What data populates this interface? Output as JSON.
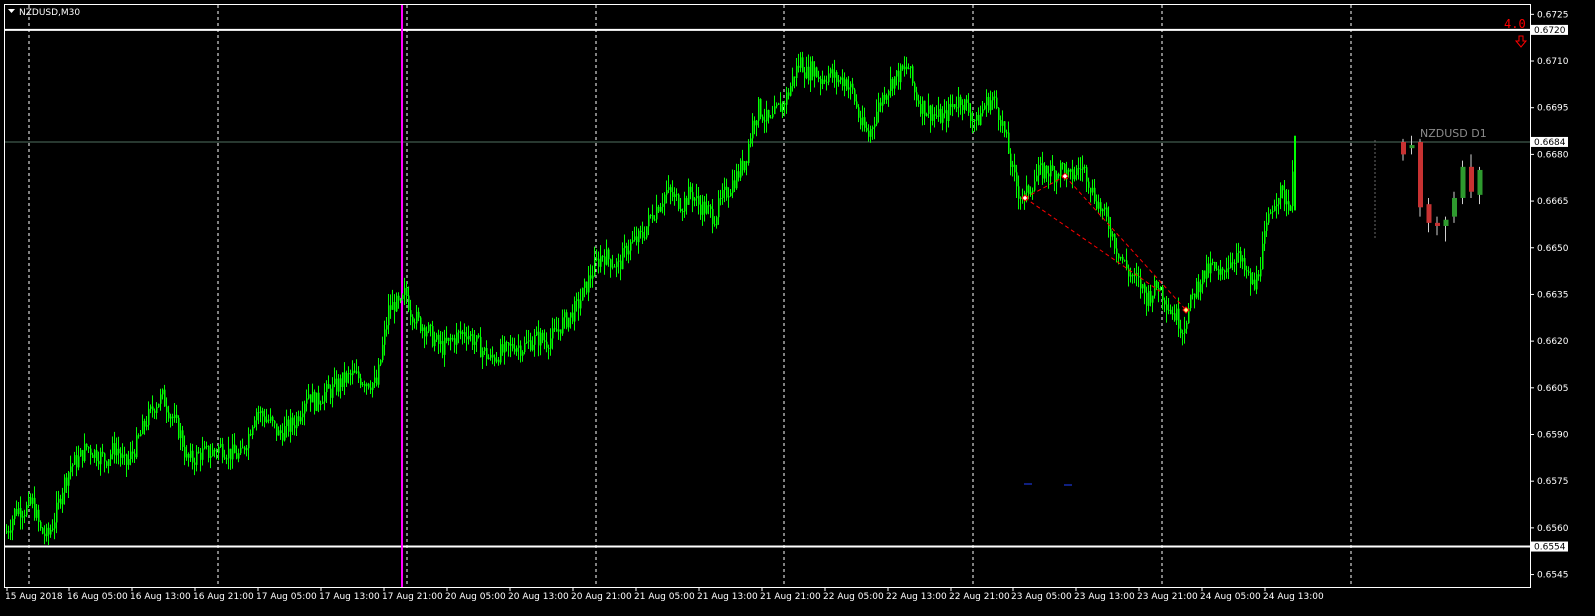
{
  "window": {
    "symbol_label": "NZDUSD,M30",
    "dropdown_icon": "triangle-down-icon"
  },
  "colors": {
    "background": "#000000",
    "bull_candle": "#00ff00",
    "bear_candle": "#00ff00",
    "grid": "#ffffff",
    "axis_text": "#ffffff",
    "bid_line": "#4f6f5f",
    "vertical_marker": "#ff00ff",
    "zigzag": "#ff0000",
    "level_line": "#ffffff",
    "alert_text": "#ff0000",
    "d1_label": "#8c8c8c",
    "d1_bull": "#2e9a2e",
    "d1_bear": "#c83232"
  },
  "chart_data": {
    "type": "candlestick",
    "title": "NZDUSD,M30",
    "y_ticks": [
      "0.6725",
      "0.6710",
      "0.6695",
      "0.6680",
      "0.6665",
      "0.6650",
      "0.6635",
      "0.6620",
      "0.6605",
      "0.6590",
      "0.6575",
      "0.6560",
      "0.6545"
    ],
    "ylim": [
      0.6541,
      0.6728
    ],
    "x_ticks": [
      "15 Aug 2018",
      "16 Aug 05:00",
      "16 Aug 13:00",
      "16 Aug 21:00",
      "17 Aug 05:00",
      "17 Aug 13:00",
      "17 Aug 21:00",
      "20 Aug 05:00",
      "20 Aug 13:00",
      "20 Aug 21:00",
      "21 Aug 05:00",
      "21 Aug 13:00",
      "21 Aug 21:00",
      "22 Aug 05:00",
      "22 Aug 13:00",
      "22 Aug 21:00",
      "23 Aug 05:00",
      "23 Aug 13:00",
      "23 Aug 21:00",
      "24 Aug 05:00",
      "24 Aug 13:00"
    ],
    "price_labels": {
      "upper_level": "0.6720",
      "bid": "0.6684",
      "lower_level": "0.6554"
    },
    "upper_level": 0.672,
    "bid": 0.6684,
    "lower_level": 0.6554,
    "close_path": [
      [
        0,
        0.6556
      ],
      [
        8,
        0.656
      ],
      [
        15,
        0.6566
      ],
      [
        25,
        0.6566
      ],
      [
        32,
        0.6568
      ],
      [
        40,
        0.6559
      ],
      [
        47,
        0.6557
      ],
      [
        55,
        0.6564
      ],
      [
        62,
        0.6573
      ],
      [
        70,
        0.658
      ],
      [
        78,
        0.6582
      ],
      [
        86,
        0.6586
      ],
      [
        95,
        0.6584
      ],
      [
        105,
        0.6582
      ],
      [
        115,
        0.6586
      ],
      [
        125,
        0.658
      ],
      [
        135,
        0.6586
      ],
      [
        145,
        0.6594
      ],
      [
        155,
        0.66
      ],
      [
        162,
        0.6602
      ],
      [
        168,
        0.6598
      ],
      [
        174,
        0.6594
      ],
      [
        180,
        0.659
      ],
      [
        186,
        0.6582
      ],
      [
        192,
        0.6582
      ],
      [
        200,
        0.6584
      ],
      [
        210,
        0.6584
      ],
      [
        220,
        0.6586
      ],
      [
        230,
        0.6584
      ],
      [
        240,
        0.6583
      ],
      [
        248,
        0.659
      ],
      [
        255,
        0.6598
      ],
      [
        262,
        0.6596
      ],
      [
        270,
        0.6594
      ],
      [
        278,
        0.659
      ],
      [
        286,
        0.6592
      ],
      [
        294,
        0.6594
      ],
      [
        300,
        0.6598
      ],
      [
        307,
        0.6604
      ],
      [
        315,
        0.66
      ],
      [
        322,
        0.6603
      ],
      [
        330,
        0.6604
      ],
      [
        337,
        0.6606
      ],
      [
        345,
        0.6608
      ],
      [
        352,
        0.6609
      ],
      [
        360,
        0.6608
      ],
      [
        368,
        0.6607
      ],
      [
        376,
        0.6606
      ],
      [
        382,
        0.6618
      ],
      [
        388,
        0.663
      ],
      [
        394,
        0.6632
      ],
      [
        400,
        0.6631
      ],
      [
        405,
        0.6636
      ],
      [
        410,
        0.663
      ],
      [
        418,
        0.6626
      ],
      [
        426,
        0.6624
      ],
      [
        434,
        0.662
      ],
      [
        442,
        0.6618
      ],
      [
        450,
        0.662
      ],
      [
        458,
        0.6622
      ],
      [
        466,
        0.6623
      ],
      [
        474,
        0.662
      ],
      [
        482,
        0.6617
      ],
      [
        490,
        0.6614
      ],
      [
        498,
        0.6616
      ],
      [
        506,
        0.6617
      ],
      [
        514,
        0.6619
      ],
      [
        522,
        0.6618
      ],
      [
        530,
        0.662
      ],
      [
        538,
        0.6621
      ],
      [
        546,
        0.662
      ],
      [
        554,
        0.6622
      ],
      [
        562,
        0.6626
      ],
      [
        570,
        0.6628
      ],
      [
        578,
        0.6632
      ],
      [
        586,
        0.6638
      ],
      [
        594,
        0.6644
      ],
      [
        602,
        0.6648
      ],
      [
        610,
        0.6646
      ],
      [
        618,
        0.6644
      ],
      [
        626,
        0.665
      ],
      [
        634,
        0.6652
      ],
      [
        642,
        0.6654
      ],
      [
        650,
        0.666
      ],
      [
        658,
        0.6664
      ],
      [
        666,
        0.6668
      ],
      [
        674,
        0.6666
      ],
      [
        682,
        0.6664
      ],
      [
        690,
        0.6668
      ],
      [
        698,
        0.6664
      ],
      [
        706,
        0.6662
      ],
      [
        714,
        0.666
      ],
      [
        722,
        0.6666
      ],
      [
        730,
        0.667
      ],
      [
        738,
        0.6674
      ],
      [
        746,
        0.668
      ],
      [
        752,
        0.669
      ],
      [
        758,
        0.6695
      ],
      [
        764,
        0.6692
      ],
      [
        770,
        0.669
      ],
      [
        776,
        0.6694
      ],
      [
        782,
        0.6696
      ],
      [
        788,
        0.67
      ],
      [
        794,
        0.6706
      ],
      [
        800,
        0.671
      ],
      [
        806,
        0.6706
      ],
      [
        812,
        0.6708
      ],
      [
        820,
        0.6704
      ],
      [
        828,
        0.6706
      ],
      [
        836,
        0.6704
      ],
      [
        844,
        0.6704
      ],
      [
        852,
        0.67
      ],
      [
        860,
        0.669
      ],
      [
        868,
        0.6686
      ],
      [
        876,
        0.6694
      ],
      [
        884,
        0.67
      ],
      [
        892,
        0.6704
      ],
      [
        900,
        0.6706
      ],
      [
        908,
        0.6708
      ],
      [
        914,
        0.67
      ],
      [
        920,
        0.6696
      ],
      [
        928,
        0.6694
      ],
      [
        936,
        0.6692
      ],
      [
        944,
        0.6692
      ],
      [
        952,
        0.6696
      ],
      [
        960,
        0.6698
      ],
      [
        968,
        0.6694
      ],
      [
        976,
        0.669
      ],
      [
        984,
        0.6696
      ],
      [
        992,
        0.6698
      ],
      [
        1000,
        0.6692
      ],
      [
        1006,
        0.6684
      ],
      [
        1012,
        0.6674
      ],
      [
        1018,
        0.6668
      ],
      [
        1024,
        0.6666
      ],
      [
        1030,
        0.667
      ],
      [
        1038,
        0.6674
      ],
      [
        1046,
        0.6675
      ],
      [
        1054,
        0.6674
      ],
      [
        1062,
        0.6676
      ],
      [
        1068,
        0.6672
      ],
      [
        1074,
        0.6674
      ],
      [
        1080,
        0.6676
      ],
      [
        1086,
        0.6674
      ],
      [
        1092,
        0.6668
      ],
      [
        1098,
        0.6664
      ],
      [
        1104,
        0.666
      ],
      [
        1110,
        0.6656
      ],
      [
        1116,
        0.665
      ],
      [
        1122,
        0.6646
      ],
      [
        1128,
        0.6642
      ],
      [
        1134,
        0.664
      ],
      [
        1140,
        0.6638
      ],
      [
        1146,
        0.6634
      ],
      [
        1152,
        0.6636
      ],
      [
        1158,
        0.6638
      ],
      [
        1164,
        0.6634
      ],
      [
        1170,
        0.663
      ],
      [
        1176,
        0.6628
      ],
      [
        1182,
        0.6624
      ],
      [
        1188,
        0.663
      ],
      [
        1194,
        0.6636
      ],
      [
        1200,
        0.664
      ],
      [
        1206,
        0.6642
      ],
      [
        1212,
        0.6644
      ],
      [
        1218,
        0.664
      ],
      [
        1224,
        0.6644
      ],
      [
        1230,
        0.6646
      ],
      [
        1236,
        0.6648
      ],
      [
        1242,
        0.6644
      ],
      [
        1248,
        0.664
      ],
      [
        1254,
        0.6637
      ],
      [
        1260,
        0.6646
      ],
      [
        1266,
        0.6656
      ],
      [
        1272,
        0.6664
      ],
      [
        1278,
        0.6668
      ],
      [
        1284,
        0.6666
      ],
      [
        1290,
        0.6664
      ],
      [
        1295,
        0.6684
      ]
    ],
    "zigzag": [
      [
        1025,
        0.6666
      ],
      [
        1065,
        0.6673
      ],
      [
        1186,
        0.663
      ]
    ],
    "zigzag_dashed_extra": [
      [
        1025,
        0.6666
      ],
      [
        1160,
        0.6636
      ]
    ],
    "d1_title": "NZDUSD D1",
    "d1_candles": [
      {
        "o": 0.6684,
        "h": 0.6685,
        "l": 0.6678,
        "c": 0.668
      },
      {
        "o": 0.6682,
        "h": 0.6686,
        "l": 0.668,
        "c": 0.6683
      },
      {
        "o": 0.6684,
        "h": 0.6685,
        "l": 0.666,
        "c": 0.6663
      },
      {
        "o": 0.6664,
        "h": 0.6666,
        "l": 0.6655,
        "c": 0.6658
      },
      {
        "o": 0.6658,
        "h": 0.666,
        "l": 0.6654,
        "c": 0.6657
      },
      {
        "o": 0.6657,
        "h": 0.666,
        "l": 0.6652,
        "c": 0.6659
      },
      {
        "o": 0.666,
        "h": 0.6668,
        "l": 0.6658,
        "c": 0.6666
      },
      {
        "o": 0.6666,
        "h": 0.6678,
        "l": 0.6664,
        "c": 0.6676
      },
      {
        "o": 0.6676,
        "h": 0.668,
        "l": 0.6666,
        "c": 0.6668
      },
      {
        "o": 0.6667,
        "h": 0.6676,
        "l": 0.6664,
        "c": 0.6675
      }
    ]
  },
  "alert": {
    "text": "4.0",
    "arrow_icon": "arrow-down-icon"
  }
}
